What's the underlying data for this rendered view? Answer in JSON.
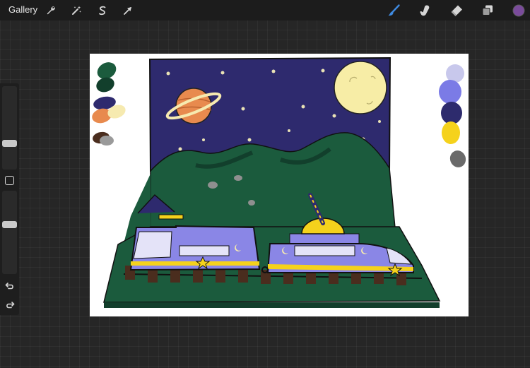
{
  "app": {
    "gallery_label": "Gallery"
  },
  "toolbar": {
    "left_tools": [
      {
        "name": "actions",
        "icon": "wrench-icon"
      },
      {
        "name": "adjustments",
        "icon": "magic-wand-icon"
      },
      {
        "name": "selection",
        "icon": "selection-s-icon"
      },
      {
        "name": "transform",
        "icon": "arrow-cursor-icon"
      }
    ],
    "right_tools": [
      {
        "name": "brush",
        "icon": "brush-icon",
        "active": true
      },
      {
        "name": "smudge",
        "icon": "smudge-finger-icon"
      },
      {
        "name": "eraser",
        "icon": "eraser-icon"
      },
      {
        "name": "layers",
        "icon": "layers-icon"
      },
      {
        "name": "color",
        "icon": "color-swatch-icon"
      }
    ],
    "active_color": "#7a4b9b",
    "active_tool_color": "#3f8ae0"
  },
  "sidebar": {
    "brush_size_level": 0.3,
    "opacity_level": 0.6,
    "undo_icon": "undo-icon",
    "redo_icon": "redo-icon"
  },
  "palette": {
    "left": [
      "#1b5b3d",
      "#123f2c",
      "#2e2a6e",
      "#e88a4e",
      "#f6eab0",
      "#4a2d1e",
      "#9a9a9a"
    ],
    "right": [
      "#c8c8ec",
      "#7b7be6",
      "#2d2b6d",
      "#f5d21c",
      "#6a6a6a"
    ]
  },
  "colors": {
    "sky": "#2e2a6e",
    "hills": "#1b5b3d",
    "moon": "#f7eda6",
    "planet": "#e88a4e",
    "train": "#8a86e6",
    "stripe": "#f5d21c"
  }
}
